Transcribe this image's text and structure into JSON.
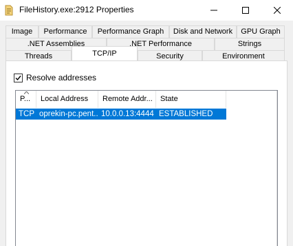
{
  "window": {
    "title": "FileHistory.exe:2912 Properties"
  },
  "tabs": {
    "row1": [
      "Image",
      "Performance",
      "Performance Graph",
      "Disk and Network",
      "GPU Graph"
    ],
    "row2": [
      ".NET Assemblies",
      ".NET Performance",
      "Strings"
    ],
    "row3": [
      "Threads",
      "TCP/IP",
      "Security",
      "Environment"
    ],
    "active": "TCP/IP"
  },
  "options": {
    "resolve_addresses": {
      "label": "Resolve addresses",
      "checked": true
    }
  },
  "list": {
    "columns": [
      "P...",
      "Local Address",
      "Remote Addr...",
      "State"
    ],
    "rows": [
      {
        "protocol": "TCP",
        "local": "oprekin-pc.pent...",
        "remote": "10.0.0.13:4444",
        "state": "ESTABLISHED",
        "selected": true
      }
    ]
  },
  "colors": {
    "selection": "#0078d7",
    "tab_bg": "#f0f0f0",
    "page_bg": "#ffffff"
  }
}
